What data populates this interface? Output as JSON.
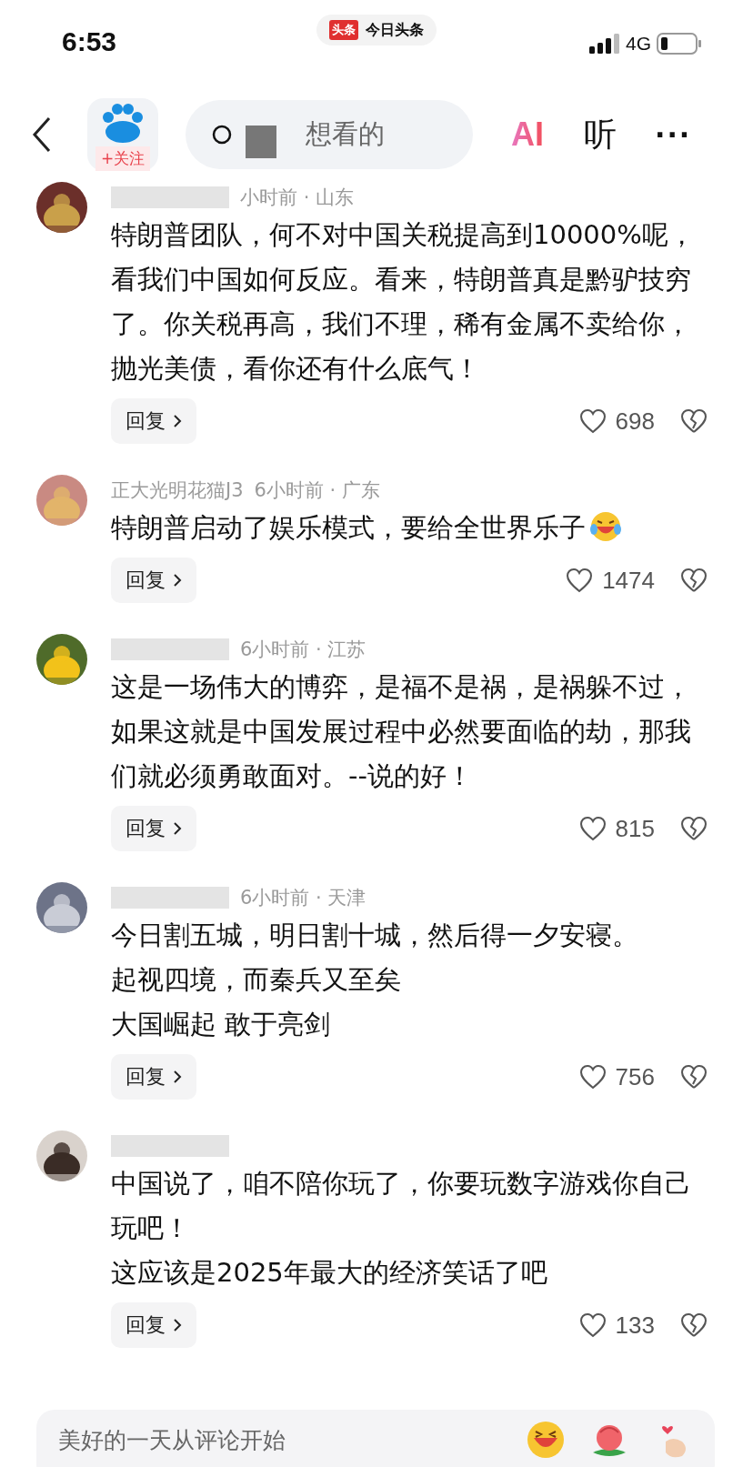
{
  "status_bar": {
    "time": "6:53",
    "app_badge": "头条",
    "app_name": "今日头条",
    "network": "4G"
  },
  "nav": {
    "follow": "+关注",
    "search_placeholder": "想看的",
    "ai": "AI",
    "listen": "听",
    "more": "···"
  },
  "comments": [
    {
      "name_hidden": true,
      "meta": "小时前 · 山东",
      "lines": [
        "特朗普团队，何不对中国关税提高到10000%呢，看我们中国如何反应。看来，特朗普真是黔驴技穷了。你关税再高，我们不理，稀有金属不卖给你，抛光美债，看你还有什么底气！"
      ],
      "emoji": false,
      "reply": "回复",
      "likes": "698"
    },
    {
      "name_hidden": false,
      "name": "正大光明花猫J3",
      "meta": "6小时前 · 广东",
      "lines": [
        "特朗普启动了娱乐模式，要给全世界乐子"
      ],
      "emoji": true,
      "reply": "回复",
      "likes": "1474"
    },
    {
      "name_hidden": true,
      "meta": "6小时前 · 江苏",
      "lines": [
        "这是一场伟大的博弈，是福不是祸，是祸躲不过，如果这就是中国发展过程中必然要面临的劫，那我们就必须勇敢面对。--说的好！"
      ],
      "emoji": false,
      "reply": "回复",
      "likes": "815"
    },
    {
      "name_hidden": true,
      "meta": "6小时前 · 天津",
      "lines": [
        "今日割五城，明日割十城，然后得一夕安寝。",
        "起视四境，而秦兵又至矣",
        "大国崛起 敢于亮剑"
      ],
      "emoji": false,
      "reply": "回复",
      "likes": "756"
    },
    {
      "name_hidden": true,
      "lines": [
        "中国说了，咱不陪你玩了，你要玩数字游戏你自己玩吧！",
        "这应该是2025年最大的经济笑话了吧"
      ],
      "emoji": false,
      "reply": "回复",
      "likes": "133"
    }
  ],
  "comment_box": {
    "placeholder": "美好的一天从评论开始"
  }
}
